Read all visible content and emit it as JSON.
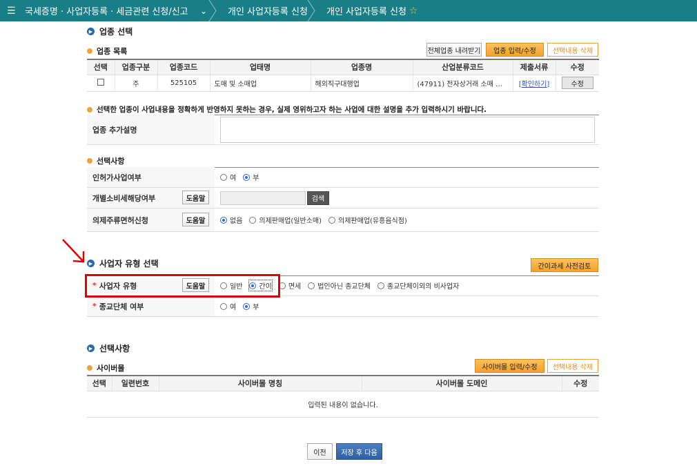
{
  "nav": {
    "crumb1": "국세증명 · 사업자등록 · 세금관련 신청/신고",
    "crumb2": "개인 사업자등록 신청",
    "crumb3": "개인 사업자등록 신청"
  },
  "section_industry": {
    "title": "업종 선택",
    "list_title": "업종 목록",
    "btn_download": "전체업종 내려받기",
    "btn_input": "업종 입력/수정",
    "btn_delete": "선택내용 삭제",
    "headers": [
      "선택",
      "업종구분",
      "업종코드",
      "업태명",
      "업종명",
      "산업분류코드",
      "제출서류",
      "수정"
    ],
    "row": {
      "kind": "주",
      "code": "525105",
      "business_type": "도매 및 소매업",
      "industry_name": "해외직구대행업",
      "class_code": "(47911) 전자상거래 소매 …",
      "doc_link": "[확인하기]",
      "edit": "수정"
    },
    "note": "선택한 업종이 사업내용을 정확하게 반영하지 못하는 경우, 실제 영위하고자 하는 사업에 대한 설명을 추가 입력하시기 바랍니다.",
    "extra_label": "업종 추가설명"
  },
  "section_options": {
    "title": "선택사항",
    "permit_label": "인허가사업여부",
    "permit_opts": [
      "여",
      "부"
    ],
    "excise_label": "개별소비세해당여부",
    "help": "도움말",
    "search": "검색",
    "liquor_label": "의제주류면허신청",
    "liquor_opts": [
      "없음",
      "의제판매업(일반소매)",
      "의제판매업(유흥음식점)"
    ]
  },
  "section_type": {
    "title": "사업자 유형 선택",
    "btn_review": "간이과세 사전검토",
    "type_label": "사업자 유형",
    "help": "도움말",
    "type_opts": [
      "일반",
      "간이",
      "면세",
      "법인아닌 종교단체",
      "종교단체이외의 비사업자"
    ],
    "religion_label": "종교단체 여부",
    "religion_opts": [
      "여",
      "부"
    ]
  },
  "section_cyber": {
    "title": "선택사항",
    "sub_title": "사이버몰",
    "btn_input": "사이버몰 입력/수정",
    "btn_delete": "선택내용 삭제",
    "headers": [
      "선택",
      "일련번호",
      "사이버몰 명칭",
      "사이버몰 도메인",
      "수정"
    ],
    "empty": "입력된 내용이 없습니다."
  },
  "footer": {
    "prev": "이전",
    "next": "저장 후 다음"
  }
}
